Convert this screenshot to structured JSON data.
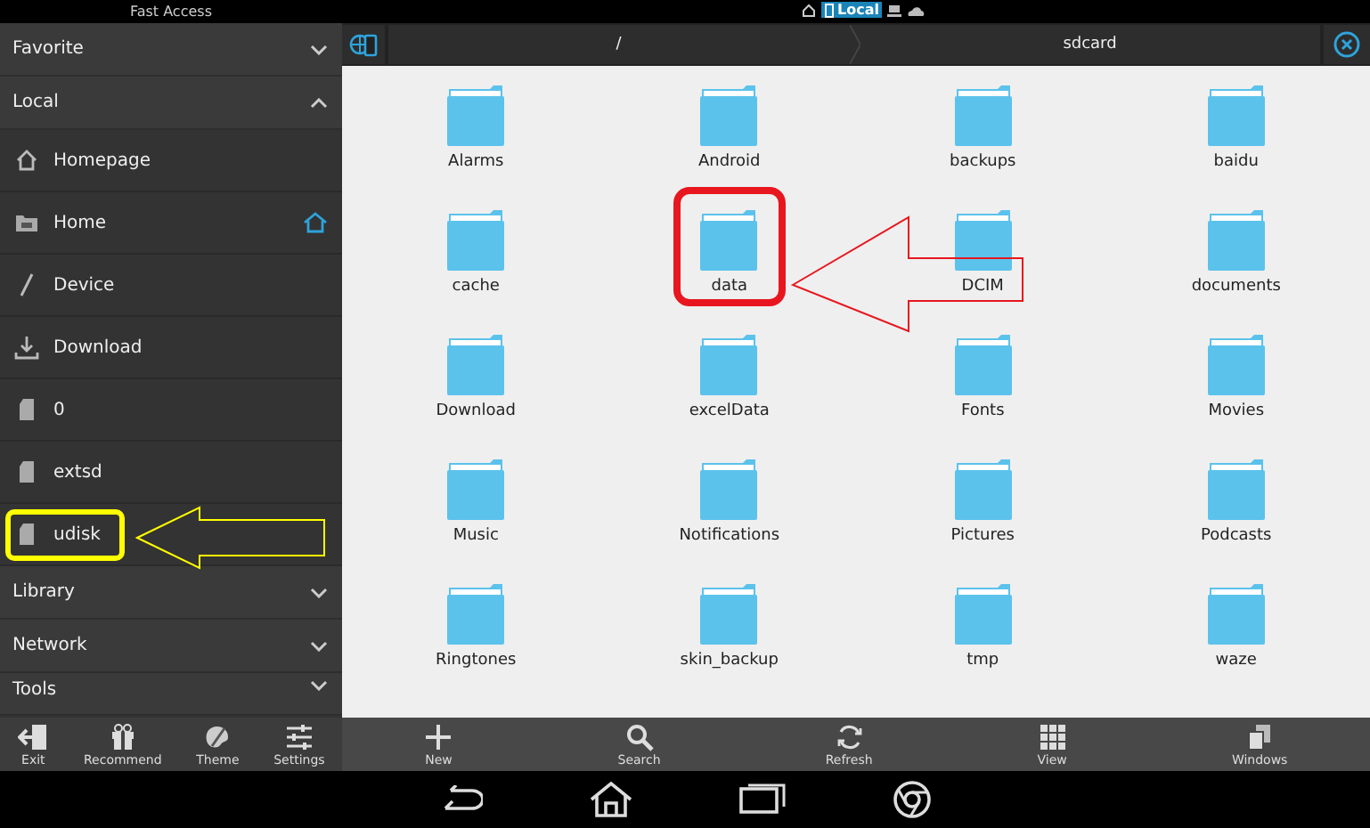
{
  "status_bar": {
    "title": "Fast Access",
    "storage_label": "Local"
  },
  "sidebar": {
    "sections": [
      {
        "label": "Favorite",
        "expanded": false
      },
      {
        "label": "Local",
        "expanded": true,
        "items": [
          {
            "label": "Homepage",
            "current": false,
            "highlighted": false
          },
          {
            "label": "Home",
            "current": true,
            "highlighted": false
          },
          {
            "label": "Device",
            "current": false,
            "highlighted": false
          },
          {
            "label": "Download",
            "current": false,
            "highlighted": false
          },
          {
            "label": "0",
            "current": false,
            "highlighted": false
          },
          {
            "label": "extsd",
            "current": false,
            "highlighted": false
          },
          {
            "label": "udisk",
            "current": false,
            "highlighted": true
          }
        ]
      },
      {
        "label": "Library",
        "expanded": false
      },
      {
        "label": "Network",
        "expanded": false
      },
      {
        "label": "Tools",
        "expanded": false
      }
    ],
    "toolbar": [
      {
        "label": "Exit"
      },
      {
        "label": "Recommend"
      },
      {
        "label": "Theme"
      },
      {
        "label": "Settings"
      }
    ]
  },
  "path_bar": {
    "crumbs": [
      "/",
      "sdcard"
    ]
  },
  "folders": [
    {
      "name": "Alarms",
      "highlighted": false
    },
    {
      "name": "Android",
      "highlighted": false
    },
    {
      "name": "backups",
      "highlighted": false
    },
    {
      "name": "baidu",
      "highlighted": false
    },
    {
      "name": "cache",
      "highlighted": false
    },
    {
      "name": "data",
      "highlighted": true
    },
    {
      "name": "DCIM",
      "highlighted": false
    },
    {
      "name": "documents",
      "highlighted": false
    },
    {
      "name": "Download",
      "highlighted": false
    },
    {
      "name": "excelData",
      "highlighted": false
    },
    {
      "name": "Fonts",
      "highlighted": false
    },
    {
      "name": "Movies",
      "highlighted": false
    },
    {
      "name": "Music",
      "highlighted": false
    },
    {
      "name": "Notifications",
      "highlighted": false
    },
    {
      "name": "Pictures",
      "highlighted": false
    },
    {
      "name": "Podcasts",
      "highlighted": false
    },
    {
      "name": "Ringtones",
      "highlighted": false
    },
    {
      "name": "skin_backup",
      "highlighted": false
    },
    {
      "name": "tmp",
      "highlighted": false
    },
    {
      "name": "waze",
      "highlighted": false
    }
  ],
  "toolbar": [
    {
      "label": "New"
    },
    {
      "label": "Search"
    },
    {
      "label": "Refresh"
    },
    {
      "label": "View"
    },
    {
      "label": "Windows"
    }
  ]
}
